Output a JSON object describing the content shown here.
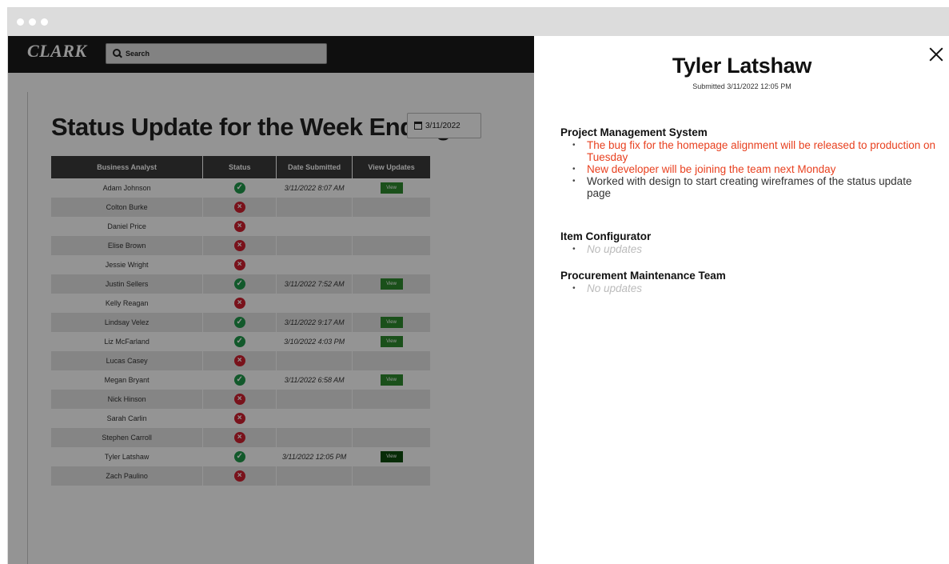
{
  "app": {
    "logo": "CLARK",
    "search_label": "Search",
    "heading": "Status Update for the Week Ending:",
    "week_ending": "3/11/2022"
  },
  "table": {
    "headers": [
      "Business Analyst",
      "Status",
      "Date Submitted",
      "View Updates"
    ],
    "view_label": "View",
    "rows": [
      {
        "name": "Adam Johnson",
        "status": "submitted",
        "date": "3/11/2022 8:07 AM"
      },
      {
        "name": "Colton Burke",
        "status": "missing",
        "date": ""
      },
      {
        "name": "Daniel Price",
        "status": "missing",
        "date": ""
      },
      {
        "name": "Elise Brown",
        "status": "missing",
        "date": ""
      },
      {
        "name": "Jessie Wright",
        "status": "missing",
        "date": ""
      },
      {
        "name": "Justin Sellers",
        "status": "submitted",
        "date": "3/11/2022 7:52 AM"
      },
      {
        "name": "Kelly Reagan",
        "status": "missing",
        "date": ""
      },
      {
        "name": "Lindsay Velez",
        "status": "submitted",
        "date": "3/11/2022 9:17 AM"
      },
      {
        "name": "Liz McFarland",
        "status": "submitted",
        "date": "3/10/2022 4:03 PM"
      },
      {
        "name": "Lucas Casey",
        "status": "missing",
        "date": ""
      },
      {
        "name": "Megan Bryant",
        "status": "submitted",
        "date": "3/11/2022 6:58 AM"
      },
      {
        "name": "Nick Hinson",
        "status": "missing",
        "date": ""
      },
      {
        "name": "Sarah Carlin",
        "status": "missing",
        "date": ""
      },
      {
        "name": "Stephen Carroll",
        "status": "missing",
        "date": ""
      },
      {
        "name": "Tyler Latshaw",
        "status": "submitted",
        "date": "3/11/2022 12:05 PM",
        "selected": true
      },
      {
        "name": "Zach Paulino",
        "status": "missing",
        "date": ""
      }
    ]
  },
  "panel": {
    "name": "Tyler Latshaw",
    "submitted": "Submitted 3/11/2022 12:05 PM",
    "projects": [
      {
        "title": "Project Management System",
        "items": [
          {
            "text": "The bug fix for the homepage alignment will be released to production on Tuesday",
            "style": "red"
          },
          {
            "text": "New developer will be joining the team next Monday",
            "style": "red"
          },
          {
            "text": "Worked with design to start creating wireframes of the status update page",
            "style": "dark"
          }
        ]
      },
      {
        "title": "Item Configurator",
        "items": [
          {
            "text": "No updates",
            "style": "none"
          }
        ]
      },
      {
        "title": "Procurement Maintenance Team",
        "items": [
          {
            "text": "No updates",
            "style": "none"
          }
        ]
      }
    ]
  },
  "colors": {
    "submitted_green": "#1f9a4a",
    "missing_red": "#d02030",
    "highlight_red": "#e8401f",
    "header_dark": "#3b3b3b"
  }
}
